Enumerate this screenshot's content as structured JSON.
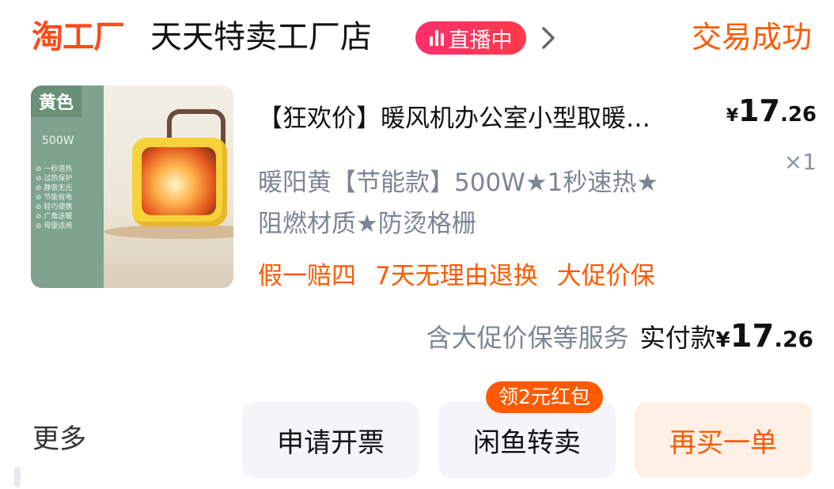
{
  "header": {
    "logo_text": "淘工厂",
    "shop_name": "天天特卖工厂店",
    "live_badge": "直播中",
    "status": "交易成功"
  },
  "product": {
    "image_tag": "黄色",
    "image_watt": "500W",
    "image_features": [
      "一秒速热",
      "过热保护",
      "静音无光",
      "节能省电",
      "轻巧便携",
      "广角送暖",
      "母婴适用"
    ],
    "title": "【狂欢价】暖风机办公室小型取暖…",
    "price": {
      "currency": "¥",
      "integer": "17",
      "decimal": ".26"
    },
    "quantity": "×1",
    "spec_lines": [
      "暖阳黄【节能款】500W★1秒速热★",
      "阻燃材质★防烫格栅"
    ],
    "guarantees": [
      "假一赔四",
      "7天无理由退换",
      "大促价保"
    ]
  },
  "summary": {
    "note": "含大促价保等服务",
    "label": "实付款",
    "price": {
      "currency": "¥",
      "integer": "17",
      "decimal": ".26"
    }
  },
  "actions": {
    "more": "更多",
    "invoice": "申请开票",
    "xianyu": "闲鱼转卖",
    "xianyu_coupon": "领2元红包",
    "rebuy": "再买一单"
  },
  "colors": {
    "accent": "#ff5a00",
    "live": "#ff2f6c",
    "muted": "#7b8594",
    "button_bg": "#f3f5f9"
  },
  "icons": {
    "live": "live-bars-icon",
    "chevron": "chevron-right-icon"
  }
}
